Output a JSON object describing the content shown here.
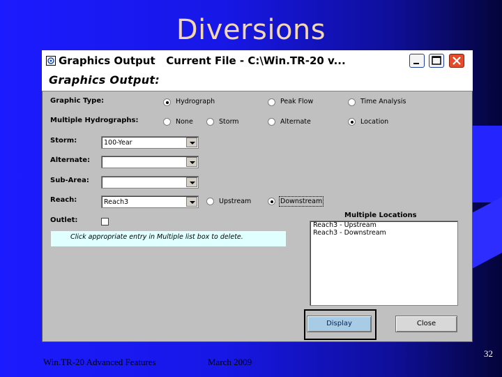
{
  "slide": {
    "title": "Diversions",
    "footer_left": "Win.TR-20 Advanced Features",
    "footer_date": "March 2009",
    "page_number": "32"
  },
  "window": {
    "title": "Graphics Output   Current File - C:\\Win.TR-20 v...",
    "header": "Graphics Output:",
    "colors": {
      "hint_bg": "#e0ffff",
      "display_button": "#a8cce6",
      "close_control": "#e34d2b"
    }
  },
  "form": {
    "graphic_type": {
      "label": "Graphic Type:",
      "options": [
        "Hydrograph",
        "Peak Flow",
        "Time Analysis"
      ],
      "selected": "Hydrograph"
    },
    "multiple_hydrographs": {
      "label": "Multiple Hydrographs:",
      "options": [
        "None",
        "Storm",
        "Alternate",
        "Location"
      ],
      "selected": "Location"
    },
    "storm": {
      "label": "Storm:",
      "value": "100-Year"
    },
    "alternate": {
      "label": "Alternate:",
      "value": ""
    },
    "sub_area": {
      "label": "Sub-Area:",
      "value": ""
    },
    "reach": {
      "label": "Reach:",
      "value": "Reach3",
      "options": [
        "Upstream",
        "Downstream"
      ],
      "selected": "Downstream"
    },
    "outlet": {
      "label": "Outlet:",
      "checked": false
    },
    "hint": "Click appropriate entry in Multiple list box to delete."
  },
  "multiple_locations": {
    "title": "Multiple Locations",
    "items": [
      "Reach3 - Upstream",
      "Reach3 - Downstream"
    ]
  },
  "buttons": {
    "display": "Display",
    "close": "Close"
  }
}
